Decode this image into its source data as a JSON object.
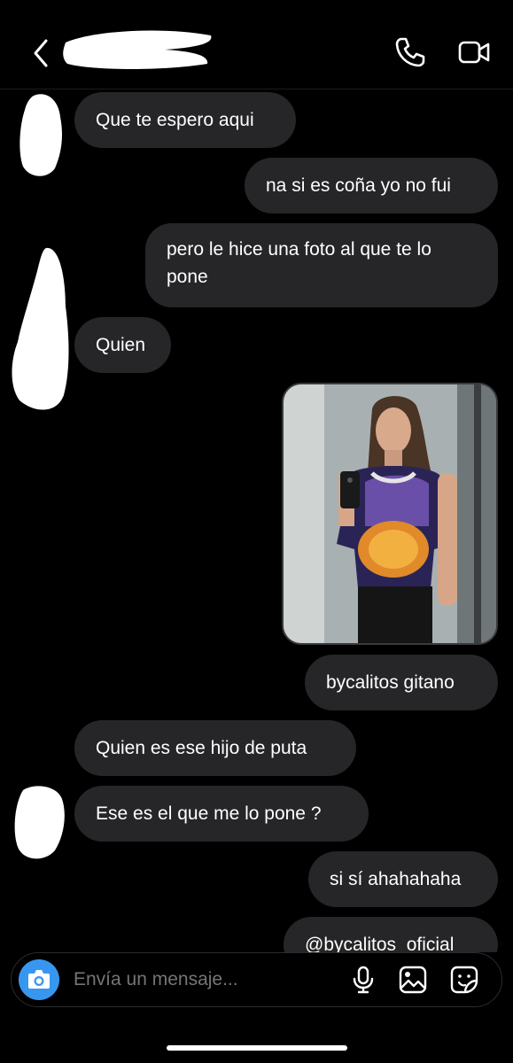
{
  "header": {
    "back_icon": "chevron-left-icon",
    "call_icon": "phone-icon",
    "video_icon": "video-camera-icon"
  },
  "messages": [
    {
      "side": "received",
      "text": "Que te espero aqui"
    },
    {
      "side": "sent",
      "text": "na si es coña yo no fui"
    },
    {
      "side": "sent",
      "text": "pero le hice una foto al que te lo pone"
    },
    {
      "side": "received",
      "text": "Quien"
    },
    {
      "side": "sent",
      "type": "image"
    },
    {
      "side": "sent",
      "text": "bycalitos gitano"
    },
    {
      "side": "received",
      "text": "Quien es ese hijo de puta"
    },
    {
      "side": "received",
      "text": "Ese es el que me lo pone ?"
    },
    {
      "side": "sent",
      "text": "si sí ahahahaha"
    },
    {
      "side": "sent",
      "text": "@bycalitos_oficial"
    }
  ],
  "composer": {
    "placeholder": "Envía un mensaje...",
    "camera_icon": "camera-icon",
    "mic_icon": "microphone-icon",
    "gallery_icon": "gallery-icon",
    "sticker_icon": "sticker-icon"
  },
  "colors": {
    "background": "#000000",
    "bubble": "#262628",
    "accent": "#3797f0"
  }
}
